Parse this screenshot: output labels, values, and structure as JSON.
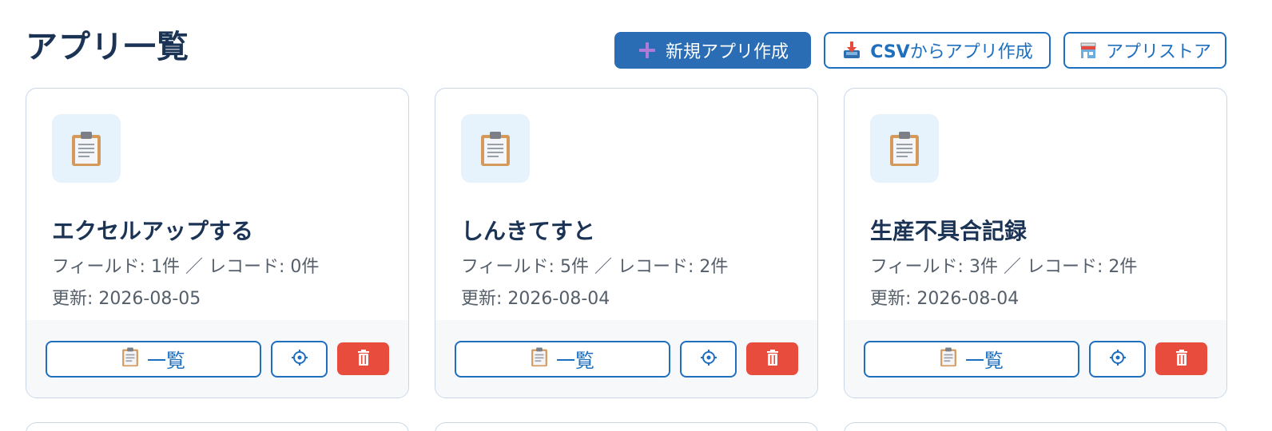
{
  "header": {
    "title": "アプリ一覧",
    "actions": {
      "new_app": "新規アプリ作成",
      "csv_bold": "CSV",
      "csv_rest": "からアプリ作成",
      "store": "アプリストア"
    }
  },
  "colors": {
    "primary": "#2a6db5",
    "accent_border": "#1f6fbf",
    "delete": "#e74c3c",
    "title": "#1b3354"
  },
  "cards": [
    {
      "icon": "clipboard-icon",
      "title": "エクセルアップする",
      "meta": "フィールド: 1件 ／ レコード: 0件",
      "updated": "更新: 2026-08-05",
      "list_label": "一覧"
    },
    {
      "icon": "clipboard-icon",
      "title": "しんきてすと",
      "meta": "フィールド: 5件 ／ レコード: 2件",
      "updated": "更新: 2026-08-04",
      "list_label": "一覧"
    },
    {
      "icon": "clipboard-icon",
      "title": "生産不具合記録",
      "meta": "フィールド: 3件 ／ レコード: 2件",
      "updated": "更新: 2026-08-04",
      "list_label": "一覧"
    }
  ]
}
